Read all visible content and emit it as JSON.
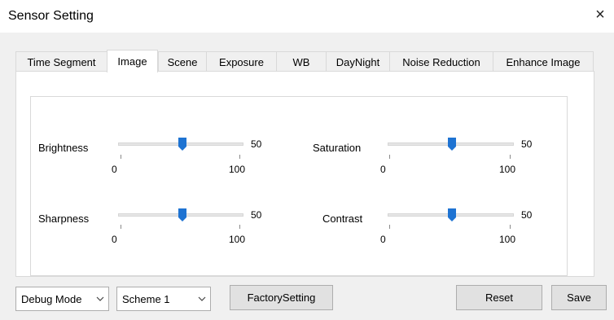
{
  "window": {
    "title": "Sensor Setting",
    "close_label": "×"
  },
  "tabs": [
    {
      "label": "Time Segment",
      "active": false
    },
    {
      "label": "Image",
      "active": true
    },
    {
      "label": "Scene",
      "active": false
    },
    {
      "label": "Exposure",
      "active": false
    },
    {
      "label": "WB",
      "active": false
    },
    {
      "label": "DayNight",
      "active": false
    },
    {
      "label": "Noise Reduction",
      "active": false
    },
    {
      "label": "Enhance Image",
      "active": false
    }
  ],
  "sliders": {
    "brightness": {
      "label": "Brightness",
      "value": "50",
      "min": "0",
      "max": "100"
    },
    "saturation": {
      "label": "Saturation",
      "value": "50",
      "min": "0",
      "max": "100"
    },
    "sharpness": {
      "label": "Sharpness",
      "value": "50",
      "min": "0",
      "max": "100"
    },
    "contrast": {
      "label": "Contrast",
      "value": "50",
      "min": "0",
      "max": "100"
    }
  },
  "footer": {
    "mode_select": "Debug Mode",
    "scheme_select": "Scheme 1",
    "factory_label": "FactorySetting",
    "reset_label": "Reset",
    "save_label": "Save"
  },
  "colors": {
    "accent": "#1e73d2",
    "background": "#f0f0f0"
  },
  "icons": {
    "close": "close-icon",
    "dropdown": "chevron-down-icon"
  }
}
